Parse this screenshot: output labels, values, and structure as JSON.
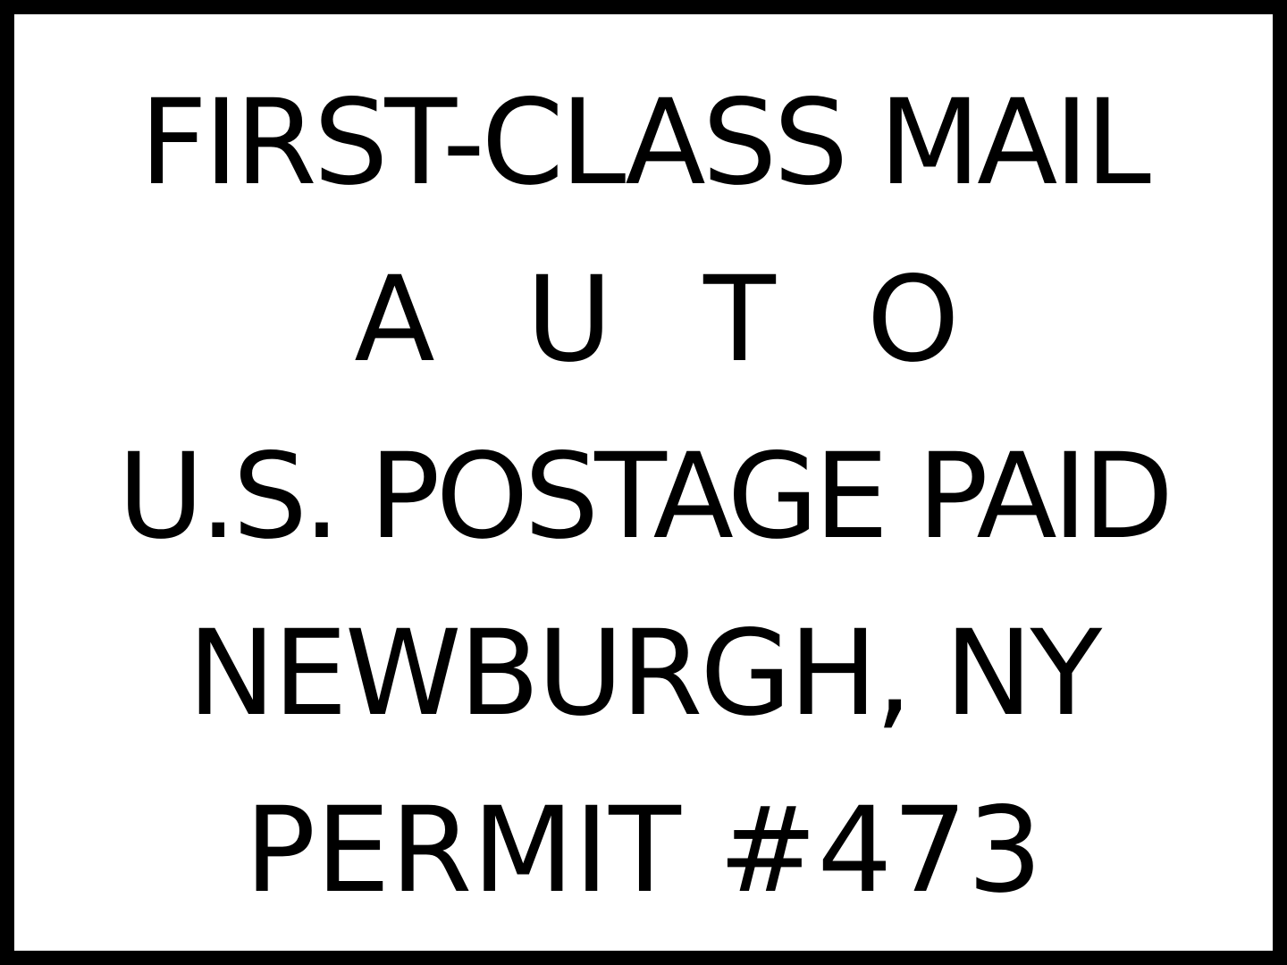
{
  "indicia": {
    "mail_class": "FIRST-CLASS MAIL",
    "sort": "A U T O",
    "postage": "U.S. POSTAGE PAID",
    "location": "NEWBURGH, NY",
    "permit": "PERMIT #473"
  },
  "colors": {
    "border": "#000000",
    "text": "#000000",
    "background": "#ffffff"
  }
}
